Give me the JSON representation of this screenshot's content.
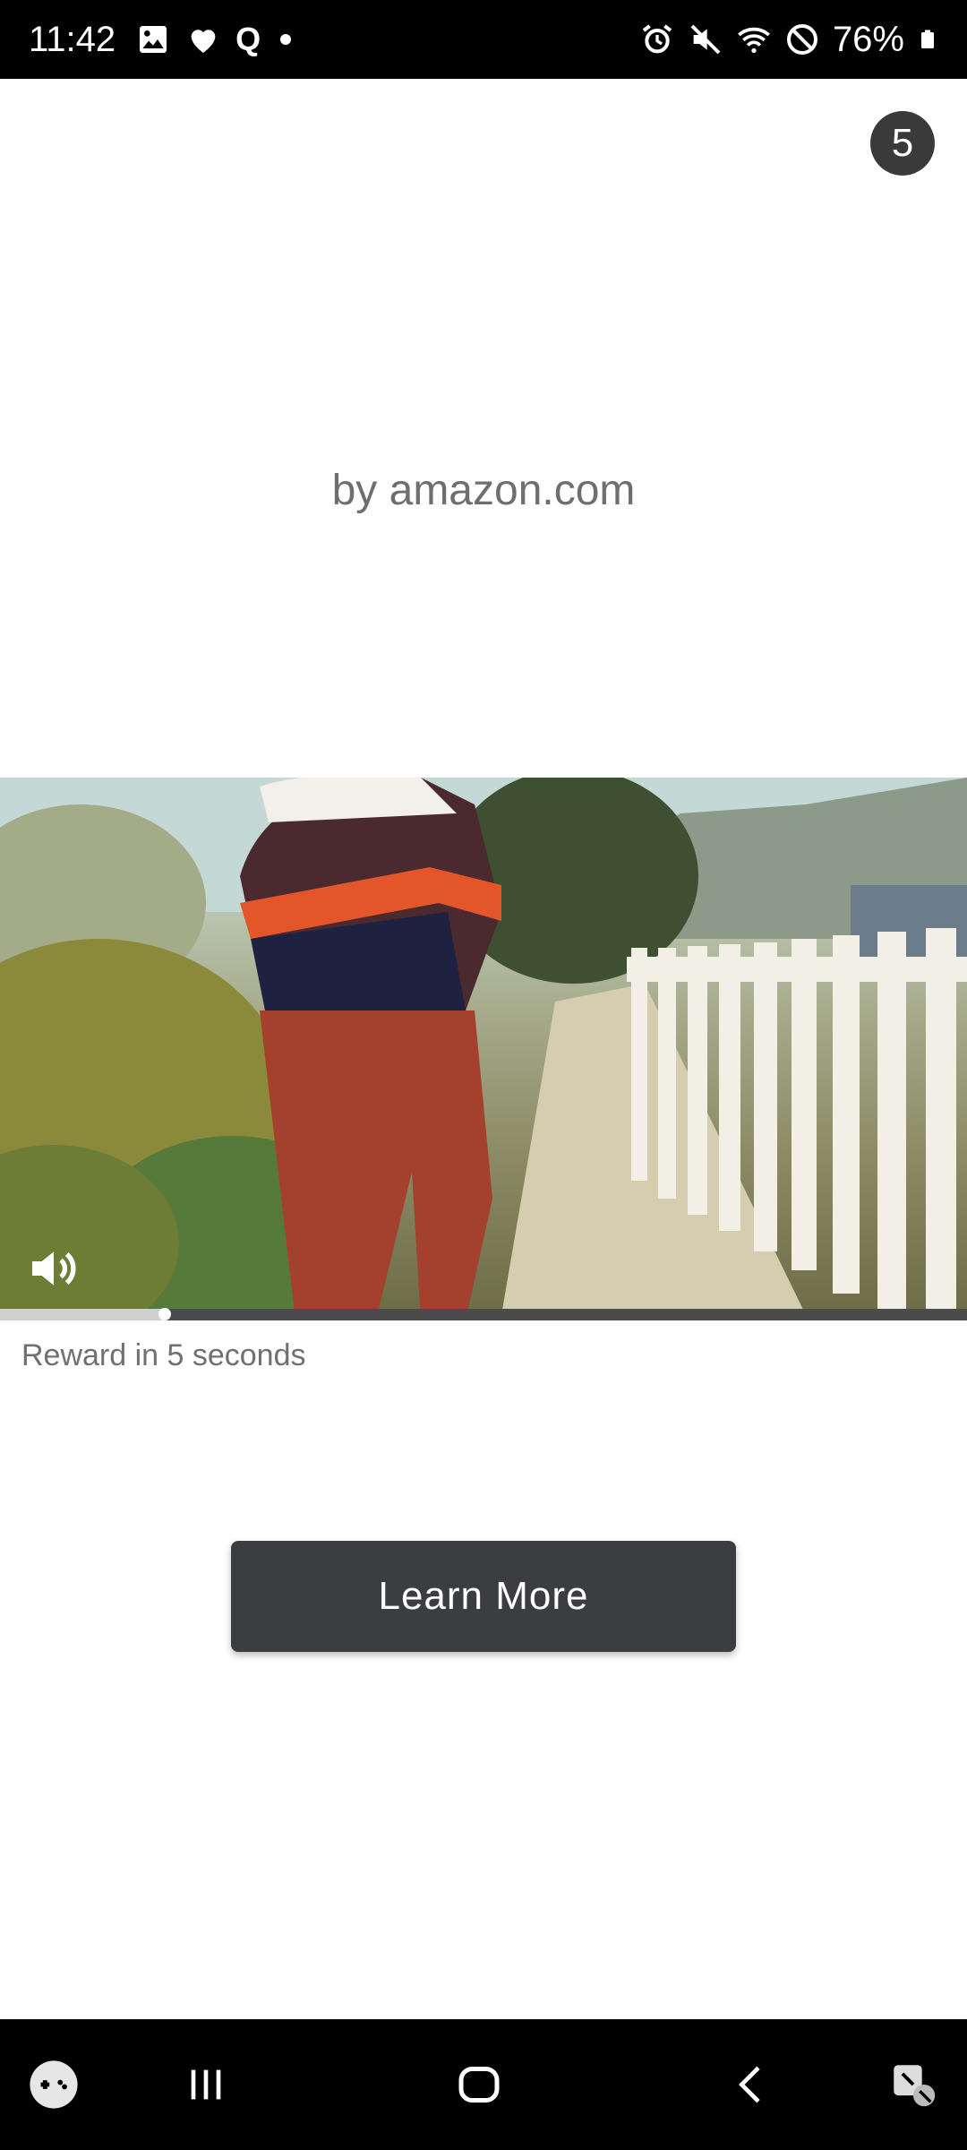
{
  "status_bar": {
    "time": "11:42",
    "battery": "76%",
    "left_icons": [
      "image-icon",
      "heart-icon",
      "q-icon",
      "dot-icon"
    ],
    "right_icons": [
      "alarm-icon",
      "mute-icon",
      "wifi-icon",
      "do-not-disturb-icon",
      "battery-icon"
    ],
    "q_letter": "Q"
  },
  "ad": {
    "countdown": "5",
    "advertiser": "by amazon.com",
    "reward_text": "Reward in 5 seconds",
    "cta_label": "Learn More",
    "video": {
      "progress": 0.17,
      "mute_icon": "volume-icon"
    }
  },
  "nav_bar": {
    "items": [
      "game-launcher-icon",
      "recent-apps-icon",
      "home-icon",
      "back-icon",
      "assistant-icon"
    ]
  }
}
